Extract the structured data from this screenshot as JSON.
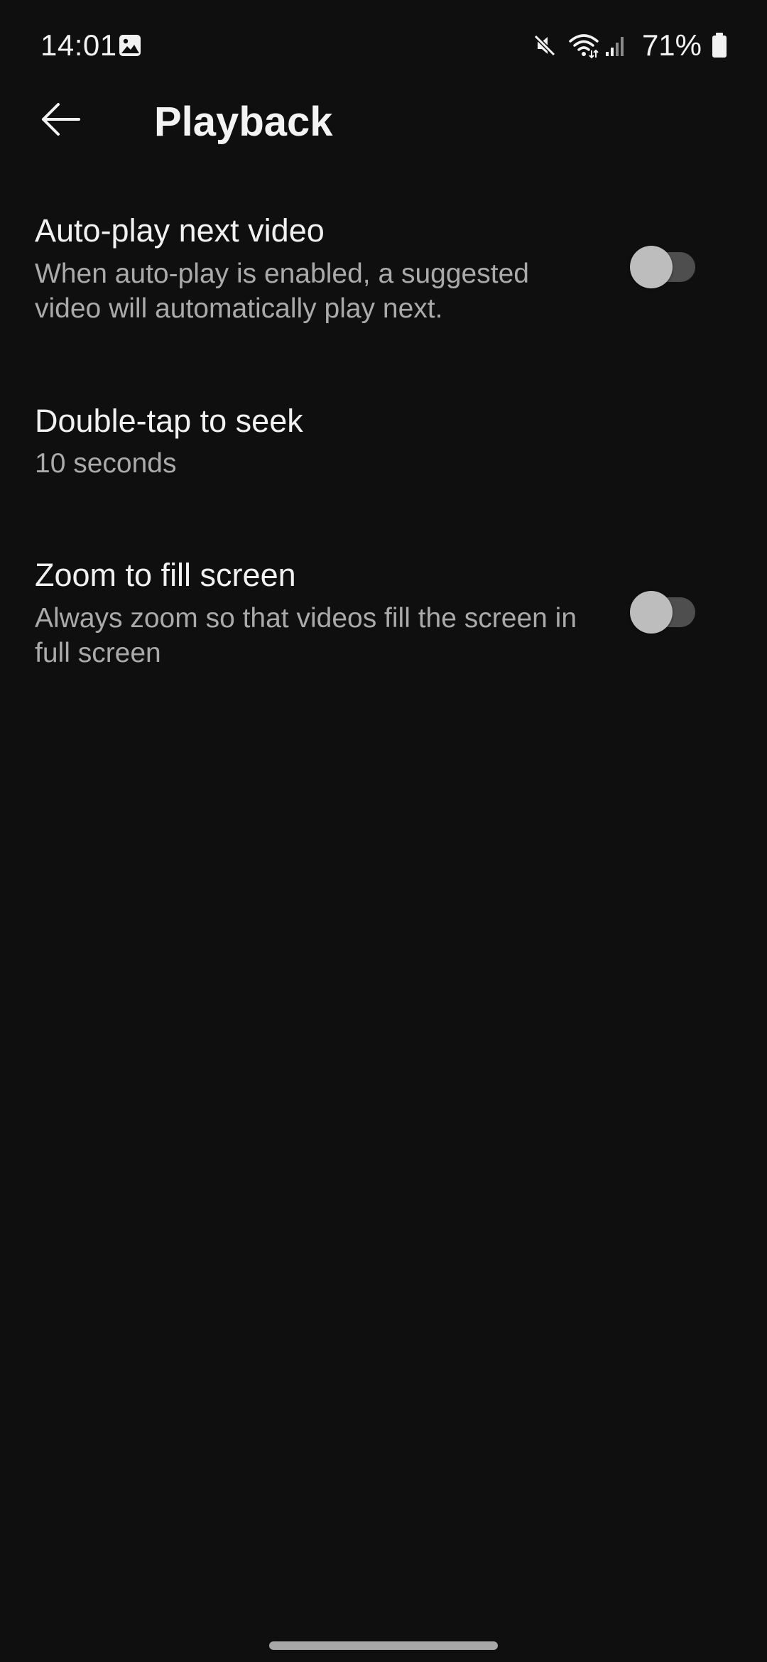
{
  "status_bar": {
    "time": "14:01",
    "battery_percent": "71%",
    "icons": [
      "gallery-icon",
      "mute-icon",
      "wifi-icon",
      "cell-signal-icon",
      "battery-icon"
    ]
  },
  "header": {
    "title": "Playback",
    "back_icon": "arrow-left-icon"
  },
  "settings": [
    {
      "title": "Auto-play next video",
      "description": "When auto-play is enabled, a suggested video will automatically play next.",
      "control": "toggle",
      "enabled": false
    },
    {
      "title": "Double-tap to seek",
      "description": "10 seconds",
      "control": "none"
    },
    {
      "title": "Zoom to fill screen",
      "description": "Always zoom so that videos fill the screen in full screen",
      "control": "toggle",
      "enabled": false
    }
  ],
  "colors": {
    "background": "#0f0f0f",
    "primary_text": "#f1f1f1",
    "secondary_text": "#aaaaaa",
    "toggle_track_off": "#4e4e4e",
    "toggle_thumb_off": "#bdbdbd"
  }
}
